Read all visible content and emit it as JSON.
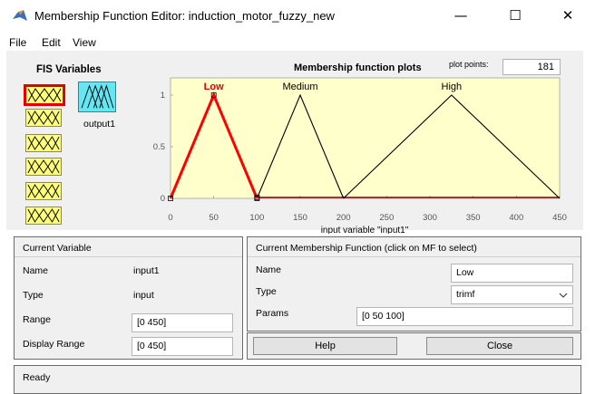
{
  "window": {
    "title": "Membership Function Editor: induction_motor_fuzzy_new",
    "minimize": "—",
    "maximize": "☐",
    "close": "✕"
  },
  "menu": {
    "file": "File",
    "edit": "Edit",
    "view": "View"
  },
  "fis": {
    "title": "FIS Variables",
    "output_label": "output1"
  },
  "plot": {
    "title": "Membership function plots",
    "plot_points_label": "plot points:",
    "plot_points_value": "181",
    "xlabel": "input variable \"input1\""
  },
  "chart_data": {
    "type": "line",
    "xlim": [
      0,
      450
    ],
    "ylim": [
      0,
      1
    ],
    "x_ticks": [
      "0",
      "50",
      "100",
      "150",
      "200",
      "250",
      "300",
      "350",
      "400",
      "450"
    ],
    "y_ticks": [
      "0",
      "0.5",
      "1"
    ],
    "series": [
      {
        "name": "Low",
        "x": [
          0,
          50,
          100
        ],
        "y": [
          0,
          1,
          0
        ],
        "color": "#ff0000",
        "selected": true
      },
      {
        "name": "Medium",
        "x": [
          100,
          150,
          200
        ],
        "y": [
          0,
          1,
          0
        ],
        "color": "#000000"
      },
      {
        "name": "High",
        "x": [
          200,
          325,
          450
        ],
        "y": [
          0,
          1,
          0
        ],
        "color": "#000000"
      }
    ],
    "background": "#ffffcc"
  },
  "current_variable": {
    "header": "Current Variable",
    "name_label": "Name",
    "name_value": "input1",
    "type_label": "Type",
    "type_value": "input",
    "range_label": "Range",
    "range_value": "[0 450]",
    "display_range_label": "Display Range",
    "display_range_value": "[0 450]"
  },
  "current_mf": {
    "header": "Current Membership Function (click on MF to select)",
    "name_label": "Name",
    "name_value": "Low",
    "type_label": "Type",
    "type_value": "trimf",
    "params_label": "Params",
    "params_value": "[0 50 100]"
  },
  "buttons": {
    "help": "Help",
    "close": "Close"
  },
  "status": {
    "text": "Ready"
  },
  "colors": {
    "input_var": "#ffff7a",
    "output_var": "#66e6f2",
    "selected": "#e00000"
  }
}
